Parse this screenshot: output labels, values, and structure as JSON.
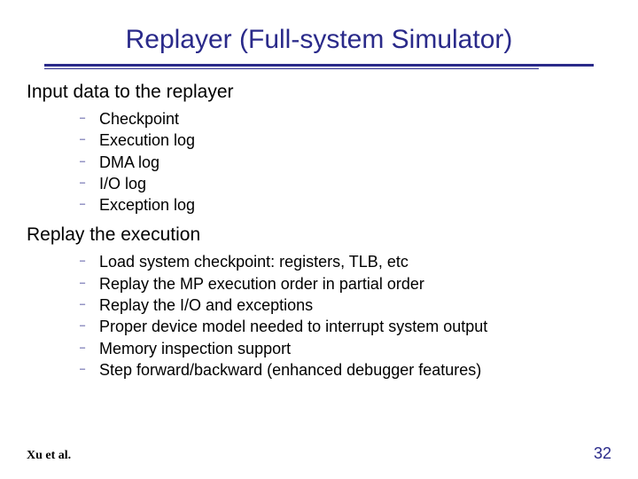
{
  "title": "Replayer (Full-system Simulator)",
  "sections": [
    {
      "heading": "Input data to the replayer",
      "items": [
        "Checkpoint",
        "Execution log",
        "DMA log",
        "I/O log",
        "Exception log"
      ]
    },
    {
      "heading": "Replay the execution",
      "items": [
        "Load system checkpoint: registers, TLB, etc",
        "Replay the MP execution order in partial order",
        "Replay the I/O and exceptions",
        "Proper device model needed to interrupt system output",
        "Memory inspection support",
        "Step forward/backward (enhanced debugger features)"
      ]
    }
  ],
  "footer": {
    "left": "Xu et al.",
    "right": "32"
  }
}
